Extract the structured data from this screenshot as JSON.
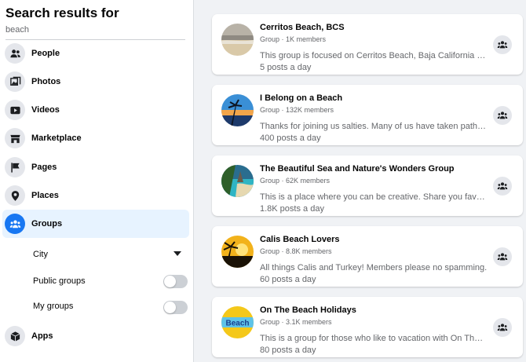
{
  "sidebar": {
    "title": "Search results for",
    "query": "beach",
    "items": [
      {
        "label": "People",
        "icon": "people-icon"
      },
      {
        "label": "Photos",
        "icon": "photos-icon"
      },
      {
        "label": "Videos",
        "icon": "videos-icon"
      },
      {
        "label": "Marketplace",
        "icon": "marketplace-icon"
      },
      {
        "label": "Pages",
        "icon": "pages-flag-icon"
      },
      {
        "label": "Places",
        "icon": "places-pin-icon"
      },
      {
        "label": "Groups",
        "icon": "groups-icon",
        "active": true
      },
      {
        "label": "Apps",
        "icon": "apps-box-icon"
      }
    ],
    "filters": {
      "city": "City",
      "public_groups": "Public groups",
      "my_groups": "My groups"
    }
  },
  "accent_color": "#1877f2",
  "results": [
    {
      "name": "Cerritos Beach, BCS",
      "meta": "Group · 1K members",
      "description": "This group is focused on Cerritos Beach, Baja California Sur, ...",
      "posts": "5 posts a day"
    },
    {
      "name": "I Belong on a Beach",
      "meta": "Group · 132K members",
      "description": "Thanks for joining us salties. Many of us have taken paths in ...",
      "posts": "400 posts a day"
    },
    {
      "name": "The Beautiful Sea and Nature's Wonders Group",
      "meta": "Group · 62K members",
      "description": "This is a place where you can be creative. Share you favorite ...",
      "posts": "1.8K posts a day"
    },
    {
      "name": "Calis Beach Lovers",
      "meta": "Group · 8.8K members",
      "description": "All things Calis and Turkey! Members please no spamming.",
      "posts": "60 posts a day"
    },
    {
      "name": "On The Beach Holidays",
      "meta": "Group · 3.1K members",
      "description": "This is a group for those who like to vacation with On The Be...",
      "posts": "80 posts a day",
      "logo_text": "Beach"
    }
  ]
}
